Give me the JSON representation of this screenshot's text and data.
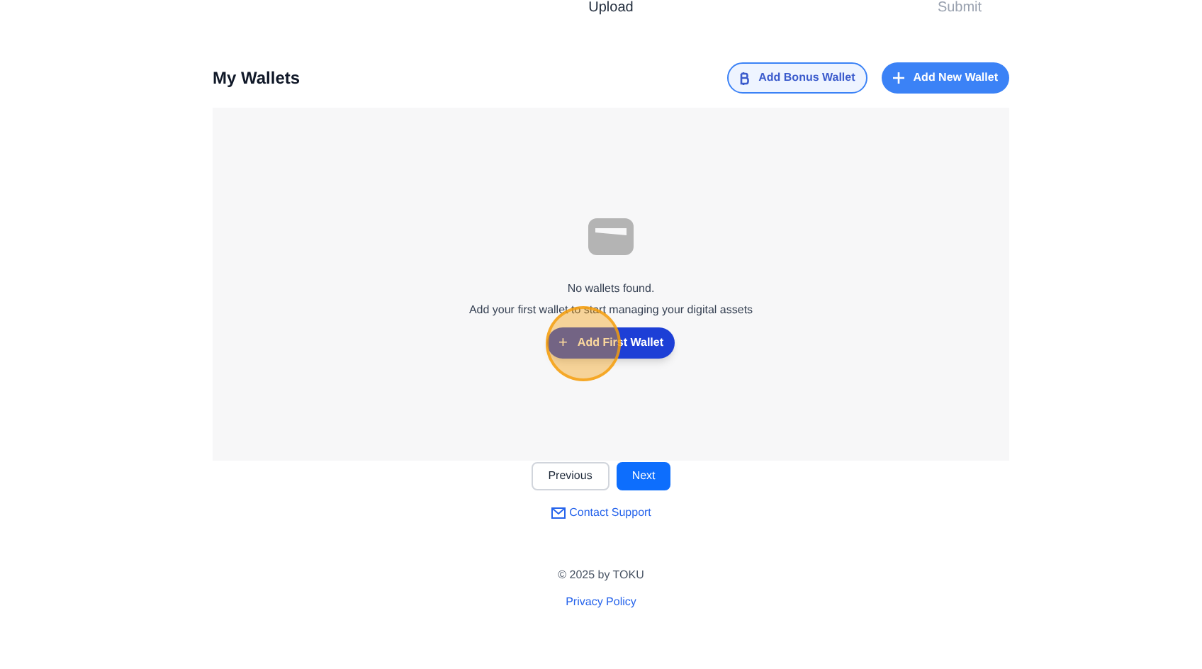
{
  "steps": [
    {
      "label": "Upload",
      "selected": true
    },
    {
      "label": "Submit",
      "selected": false
    }
  ],
  "title": "My Wallets",
  "header_buttons": [
    {
      "kind": "outline",
      "label": "Add Bonus Wallet"
    },
    {
      "kind": "solid",
      "label": "Add New Wallet"
    }
  ],
  "empty_state": {
    "message": "No wallets found.",
    "hint": "Add your first wallet to start managing your digital assets",
    "button": {
      "icon": "+",
      "label": "Add First Wallet"
    }
  },
  "nav_buttons": [
    {
      "kind": "outline",
      "label": "Previous"
    },
    {
      "kind": "solid",
      "label": "Next"
    }
  ],
  "support_link": "Contact Support",
  "footer": {
    "copyright": "© 2025 by TOKU",
    "link": "Privacy Policy"
  }
}
